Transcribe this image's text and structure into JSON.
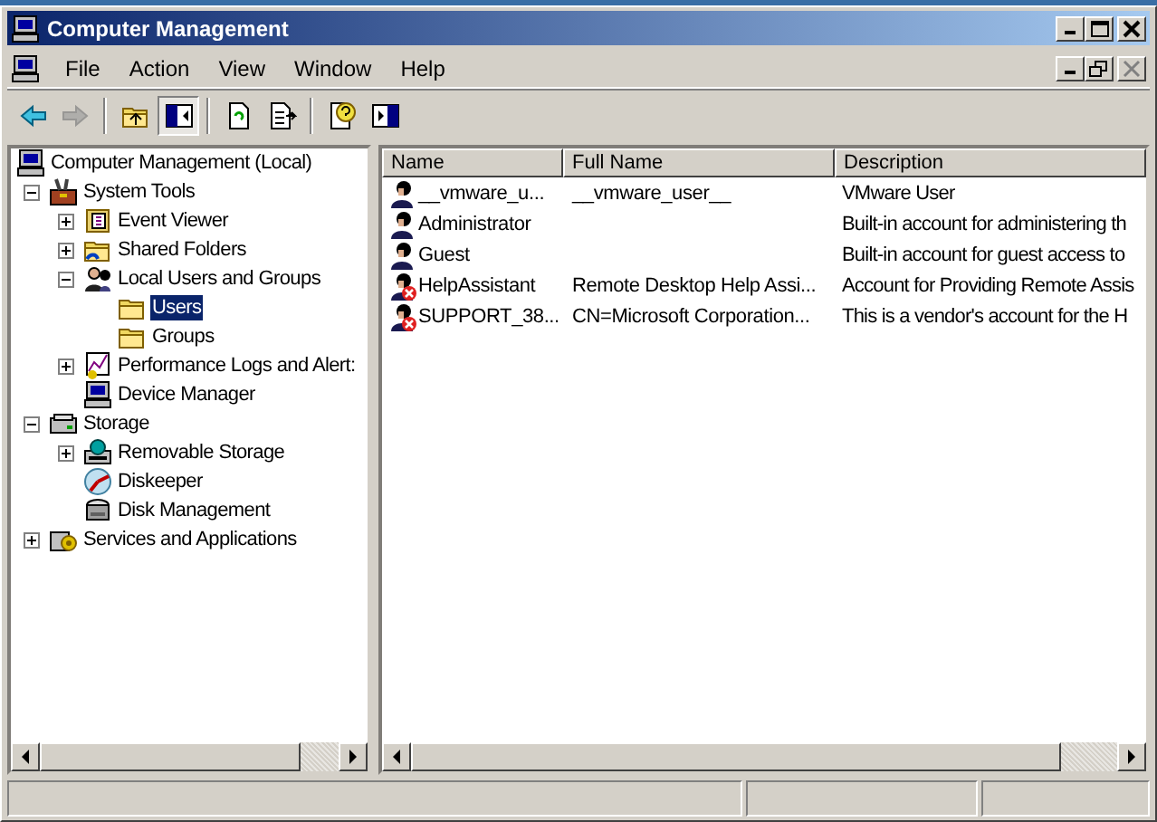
{
  "window": {
    "title": "Computer Management"
  },
  "menu": [
    "File",
    "Action",
    "View",
    "Window",
    "Help"
  ],
  "toolbar": [
    {
      "kind": "back",
      "disabled": false,
      "pressed": false
    },
    {
      "kind": "forward",
      "disabled": true,
      "pressed": false
    },
    {
      "kind": "sep"
    },
    {
      "kind": "up",
      "disabled": false,
      "pressed": false
    },
    {
      "kind": "tree",
      "disabled": false,
      "pressed": true
    },
    {
      "kind": "sep"
    },
    {
      "kind": "refresh",
      "disabled": false,
      "pressed": false
    },
    {
      "kind": "export",
      "disabled": false,
      "pressed": false
    },
    {
      "kind": "sep"
    },
    {
      "kind": "help",
      "disabled": false,
      "pressed": false
    },
    {
      "kind": "panel",
      "disabled": false,
      "pressed": false
    }
  ],
  "tree": [
    {
      "label": "Computer Management (Local)",
      "kind": "computer",
      "selected": false,
      "children": [
        {
          "label": "System Tools",
          "kind": "tools",
          "selected": false,
          "expanded": true,
          "children": [
            {
              "label": "Event Viewer",
              "kind": "event",
              "selected": false,
              "expanded": false
            },
            {
              "label": "Shared Folders",
              "kind": "share",
              "selected": false,
              "expanded": false
            },
            {
              "label": "Local Users and Groups",
              "kind": "users",
              "selected": false,
              "expanded": true,
              "children": [
                {
                  "label": "Users",
                  "kind": "folder",
                  "selected": true
                },
                {
                  "label": "Groups",
                  "kind": "folder",
                  "selected": false
                }
              ]
            },
            {
              "label": "Performance Logs and Alert:",
              "kind": "perf",
              "selected": false,
              "expanded": false
            },
            {
              "label": "Device Manager",
              "kind": "device",
              "selected": false
            }
          ]
        },
        {
          "label": "Storage",
          "kind": "storage",
          "selected": false,
          "expanded": true,
          "children": [
            {
              "label": "Removable Storage",
              "kind": "removable",
              "selected": false,
              "expanded": false
            },
            {
              "label": "Diskeeper",
              "kind": "defrag",
              "selected": false
            },
            {
              "label": "Disk Management",
              "kind": "disk",
              "selected": false
            }
          ]
        },
        {
          "label": "Services and Applications",
          "kind": "services",
          "selected": false,
          "expanded": false
        }
      ]
    }
  ],
  "table": {
    "columns": [
      "Name",
      "Full Name",
      "Description"
    ],
    "rows": [
      {
        "cells": [
          "__vmware_u...",
          "__vmware_user__",
          "VMware User"
        ],
        "disabled": false
      },
      {
        "cells": [
          "Administrator",
          "",
          "Built-in account for administering th"
        ],
        "disabled": false
      },
      {
        "cells": [
          "Guest",
          "",
          "Built-in account for guest access to"
        ],
        "disabled": false
      },
      {
        "cells": [
          "HelpAssistant",
          "Remote Desktop Help Assi...",
          "Account for Providing Remote Assis"
        ],
        "disabled": true
      },
      {
        "cells": [
          "SUPPORT_38...",
          "CN=Microsoft Corporation...",
          "This is a vendor's account for the H"
        ],
        "disabled": true
      }
    ]
  }
}
